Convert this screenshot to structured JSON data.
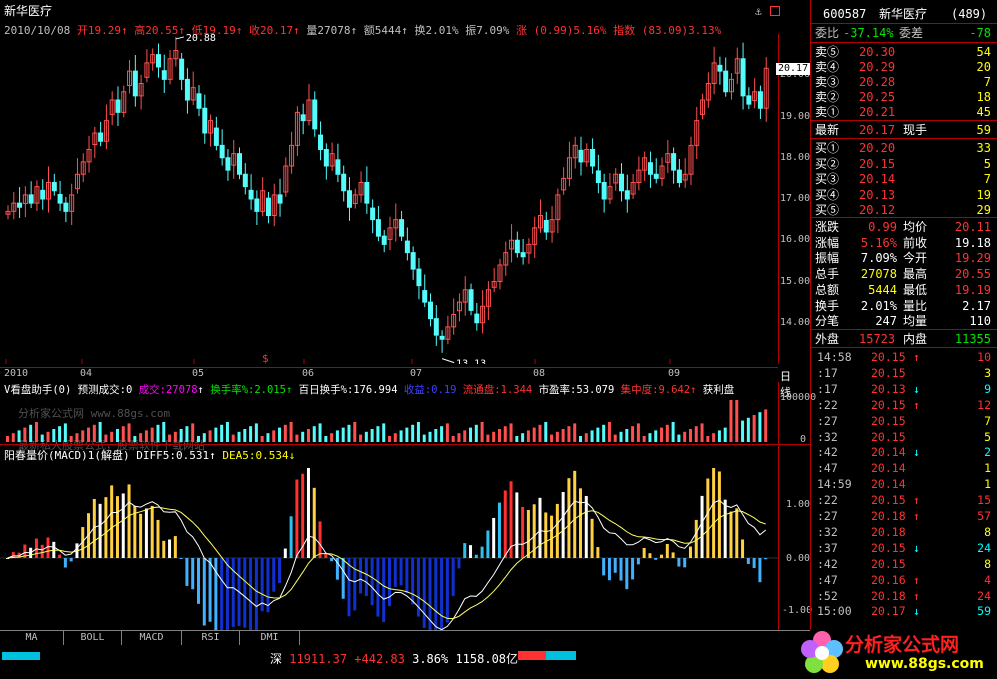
{
  "header": {
    "stock_name": "新华医疗",
    "date": "2010/10/08",
    "open": "开19.29",
    "high": "高20.55",
    "low": "低19.19",
    "close": "收20.17",
    "vol": "量27078",
    "amount": "额5444",
    "turnover": "换2.01%",
    "amplitude": "振7.09%",
    "change": "涨 (0.99)5.16%",
    "index": "指数 (83.09)3.13%"
  },
  "price_axis": [
    "20.00",
    "19.00",
    "18.00",
    "17.00",
    "16.00",
    "15.00",
    "14.00"
  ],
  "annotations": {
    "high_mark": "20.88",
    "low_mark": "13.13",
    "last_price": "20.17",
    "dollar": "$"
  },
  "time_axis": [
    "2010",
    "04",
    "05",
    "06",
    "07",
    "08",
    "09"
  ],
  "period_button": "日线",
  "indicator1": {
    "name": "V看盘助手(0)",
    "predict": "预测成交:0",
    "vol_label": "成交:27078",
    "turnover_label": "换手率%:2.015",
    "hundred_day": "百日换手%:176.994",
    "profit_label": "收益:0.19",
    "float_label": "流通盘:1.344",
    "pe_label": "市盈率:53.079",
    "concentration": "集中度:9.642",
    "profit_disk": "获利盘",
    "axis": [
      "100000",
      "0"
    ],
    "watermark": "分析家公式网 www.88gs.com",
    "promo": "最新私人股票公式，股票软件下载网站"
  },
  "indicator2": {
    "name": "阳春量价(MACD)1(解盘)",
    "diff": "DIFF5:0.531",
    "dea": "DEA5:0.534",
    "axis": [
      "1.00",
      "0.00",
      "-1.00"
    ]
  },
  "bottom_tabs": [
    "MA",
    "BOLL",
    "MACD",
    "RSI",
    "DMI"
  ],
  "status_bar": {
    "market": "深",
    "index": "11911.37",
    "change": "+442.83",
    "pct": "3.86%",
    "amount": "1158.08亿"
  },
  "logo": {
    "text": "分析家公式网",
    "url": "www.88gs.com"
  },
  "quote": {
    "code": "600587",
    "name": "新华医疗",
    "count": "(489)",
    "weibi_label": "委比",
    "weibi": "-37.14%",
    "weicha_label": "委差",
    "weicha": "-78",
    "sell": [
      {
        "label": "卖⑤",
        "price": "20.30",
        "vol": "54"
      },
      {
        "label": "卖④",
        "price": "20.29",
        "vol": "20"
      },
      {
        "label": "卖③",
        "price": "20.28",
        "vol": "7"
      },
      {
        "label": "卖②",
        "price": "20.25",
        "vol": "18"
      },
      {
        "label": "卖①",
        "price": "20.21",
        "vol": "45"
      }
    ],
    "latest_label": "最新",
    "latest": "20.17",
    "xianshou_label": "现手",
    "xianshou": "59",
    "buy": [
      {
        "label": "买①",
        "price": "20.20",
        "vol": "33"
      },
      {
        "label": "买②",
        "price": "20.15",
        "vol": "5"
      },
      {
        "label": "买③",
        "price": "20.14",
        "vol": "7"
      },
      {
        "label": "买④",
        "price": "20.13",
        "vol": "19"
      },
      {
        "label": "买⑤",
        "price": "20.12",
        "vol": "29"
      }
    ],
    "stats": [
      {
        "l1": "涨跌",
        "v1": "0.99",
        "l2": "均价",
        "v2": "20.11"
      },
      {
        "l1": "涨幅",
        "v1": "5.16%",
        "l2": "前收",
        "v2": "19.18"
      },
      {
        "l1": "振幅",
        "v1": "7.09%",
        "l2": "今开",
        "v2": "19.29"
      },
      {
        "l1": "总手",
        "v1": "27078",
        "l2": "最高",
        "v2": "20.55"
      },
      {
        "l1": "总额",
        "v1": "5444",
        "l2": "最低",
        "v2": "19.19"
      },
      {
        "l1": "换手",
        "v1": "2.01%",
        "l2": "量比",
        "v2": "2.17"
      },
      {
        "l1": "分笔",
        "v1": "247",
        "l2": "均量",
        "v2": "110"
      }
    ],
    "waipan_label": "外盘",
    "waipan": "15723",
    "neipan_label": "内盘",
    "neipan": "11355"
  },
  "ticks": [
    {
      "t": "14:58",
      "p": "20.15",
      "d": "↑",
      "v": "10"
    },
    {
      "t": ":17",
      "p": "20.15",
      "d": "",
      "v": "3"
    },
    {
      "t": ":17",
      "p": "20.13",
      "d": "↓",
      "v": "9"
    },
    {
      "t": ":22",
      "p": "20.15",
      "d": "↑",
      "v": "12"
    },
    {
      "t": ":27",
      "p": "20.15",
      "d": "",
      "v": "7"
    },
    {
      "t": ":32",
      "p": "20.15",
      "d": "",
      "v": "5"
    },
    {
      "t": ":42",
      "p": "20.14",
      "d": "↓",
      "v": "2"
    },
    {
      "t": ":47",
      "p": "20.14",
      "d": "",
      "v": "1"
    },
    {
      "t": "14:59",
      "p": "20.14",
      "d": "",
      "v": "1"
    },
    {
      "t": ":22",
      "p": "20.15",
      "d": "↑",
      "v": "15"
    },
    {
      "t": ":27",
      "p": "20.18",
      "d": "↑",
      "v": "57"
    },
    {
      "t": ":32",
      "p": "20.18",
      "d": "",
      "v": "8"
    },
    {
      "t": ":37",
      "p": "20.15",
      "d": "↓",
      "v": "24"
    },
    {
      "t": ":42",
      "p": "20.15",
      "d": "",
      "v": "8"
    },
    {
      "t": ":47",
      "p": "20.16",
      "d": "↑",
      "v": "4"
    },
    {
      "t": ":52",
      "p": "20.18",
      "d": "↑",
      "v": "24"
    },
    {
      "t": "15:00",
      "p": "20.17",
      "d": "↓",
      "v": "59"
    }
  ],
  "chart_data": {
    "type": "candlestick",
    "ylim": [
      13.0,
      21.0
    ],
    "closes": [
      16.7,
      16.9,
      16.8,
      17.1,
      16.9,
      17.3,
      17.0,
      17.4,
      17.2,
      16.9,
      16.7,
      17.1,
      17.6,
      17.9,
      18.2,
      18.6,
      18.4,
      18.9,
      19.4,
      19.1,
      19.6,
      20.1,
      19.5,
      19.8,
      20.3,
      20.5,
      20.2,
      19.9,
      20.4,
      20.6,
      19.9,
      19.4,
      19.7,
      19.2,
      18.6,
      18.9,
      18.3,
      18.0,
      17.7,
      18.1,
      17.6,
      17.3,
      17.0,
      16.7,
      17.2,
      16.6,
      17.1,
      16.9,
      17.8,
      18.3,
      19.1,
      18.9,
      19.4,
      18.7,
      18.2,
      17.8,
      18.1,
      17.6,
      17.2,
      16.8,
      17.1,
      17.4,
      16.9,
      16.5,
      16.1,
      15.9,
      16.3,
      16.5,
      16.1,
      15.7,
      15.3,
      14.9,
      14.5,
      14.1,
      13.7,
      13.6,
      13.9,
      14.2,
      14.5,
      14.8,
      14.3,
      14.0,
      14.4,
      14.8,
      15.0,
      15.4,
      15.7,
      16.0,
      15.7,
      15.6,
      15.9,
      16.3,
      16.6,
      16.2,
      16.5,
      17.1,
      17.5,
      18.0,
      18.3,
      17.9,
      18.2,
      17.8,
      17.4,
      17.0,
      17.3,
      17.6,
      17.2,
      17.0,
      17.4,
      17.7,
      18.0,
      17.6,
      17.5,
      17.8,
      18.1,
      17.7,
      17.4,
      17.6,
      18.3,
      18.9,
      19.4,
      19.8,
      20.3,
      20.1,
      19.6,
      19.9,
      20.4,
      19.5,
      19.3,
      19.6,
      19.2,
      20.17
    ],
    "series_colors": {
      "up": "#ff5050",
      "down": "#54fcfc"
    }
  }
}
